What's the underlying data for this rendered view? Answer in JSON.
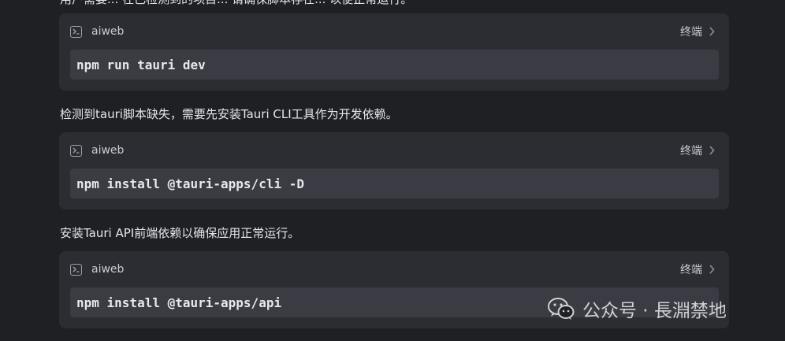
{
  "top_partial_text": "用户需要... 在已检测到的项目... 请确保脚本存在... 以便正常运行。",
  "blocks": [
    {
      "title": "aiweb",
      "terminal_label": "终端",
      "code": "npm run tauri dev"
    },
    {
      "title": "aiweb",
      "terminal_label": "终端",
      "code": "npm install @tauri-apps/cli -D"
    },
    {
      "title": "aiweb",
      "terminal_label": "终端",
      "code": "npm install @tauri-apps/api"
    }
  ],
  "paragraphs": [
    "检测到tauri脚本缺失，需要先安装Tauri CLI工具作为开发依赖。",
    "安装Tauri API前端依赖以确保应用正常运行。"
  ],
  "watermark": {
    "text": "公众号 · 長淵禁地",
    "icon": "wechat-icon"
  },
  "icons": {
    "terminal": "terminal-icon",
    "chevron": "chevron-right-icon"
  }
}
